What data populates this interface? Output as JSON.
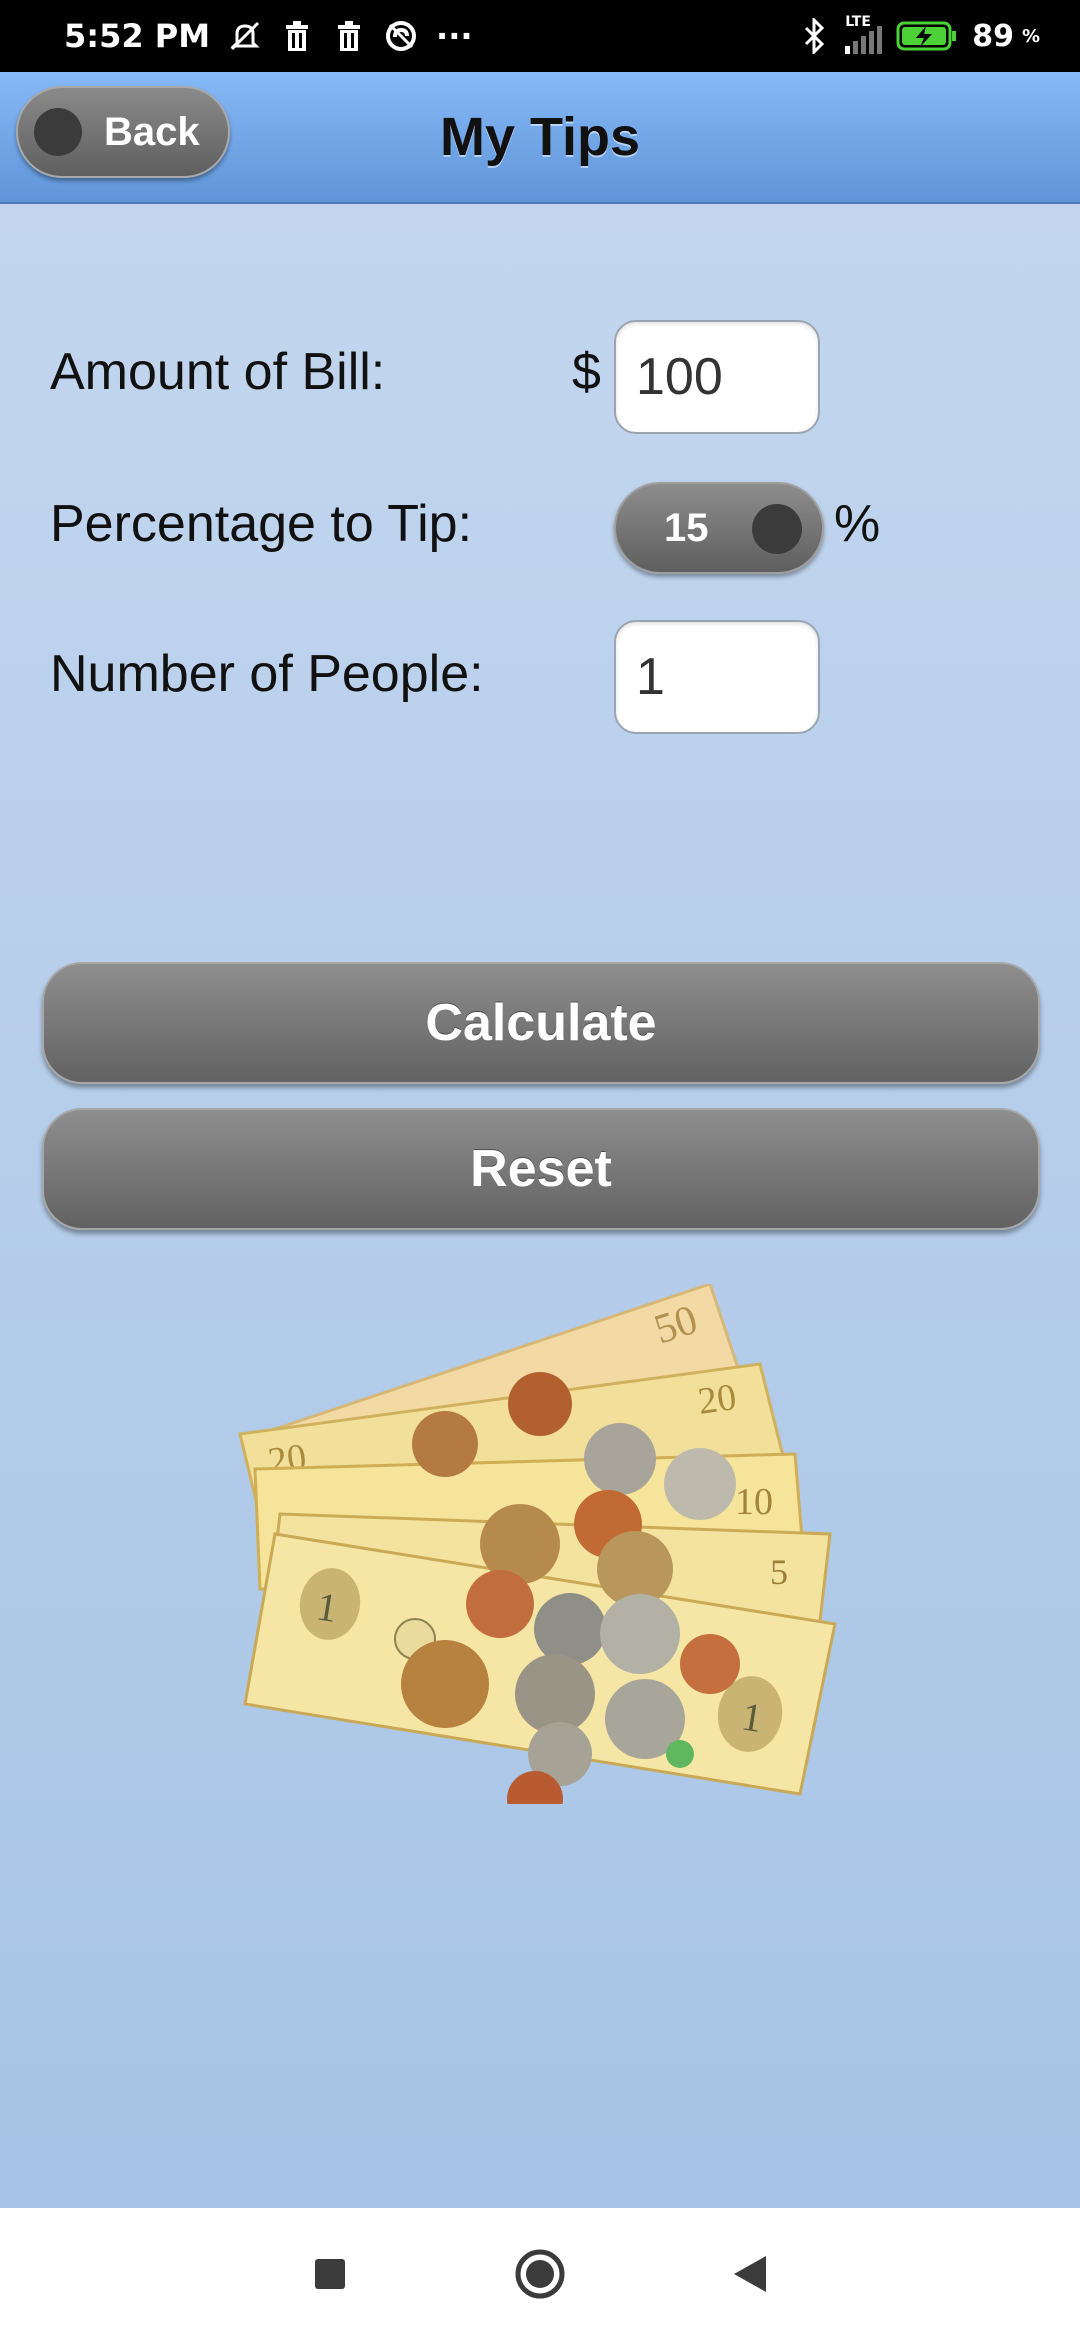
{
  "status_bar": {
    "time": "5:52 PM",
    "more": "···",
    "network": "LTE",
    "battery": "89",
    "battery_unit": "%",
    "icons": [
      "mute-icon",
      "trash-icon",
      "trash-icon",
      "sync-icon",
      "bluetooth-icon",
      "signal-icon",
      "battery-charging-icon"
    ]
  },
  "app_bar": {
    "back_label": "Back",
    "title": "My Tips"
  },
  "form": {
    "bill_label": "Amount of Bill:",
    "currency_symbol": "$",
    "bill_value": "100",
    "tip_label": "Percentage to Tip:",
    "tip_value": "15",
    "tip_unit": "%",
    "people_label": "Number of People:",
    "people_value": "1"
  },
  "actions": {
    "calculate_label": "Calculate",
    "reset_label": "Reset"
  },
  "image": {
    "icon": "money-bills-coins-illustration"
  },
  "nav_bar": {
    "icons": [
      "recents-square-icon",
      "home-circle-icon",
      "back-triangle-icon"
    ]
  },
  "colors": {
    "status_bar_bg": "#000000",
    "app_bar_top": "#86b9f7",
    "app_bar_bottom": "#5f95d8",
    "content_top": "#c3d6ee",
    "content_bottom": "#a7c4e6",
    "button_gray": "#777777"
  }
}
